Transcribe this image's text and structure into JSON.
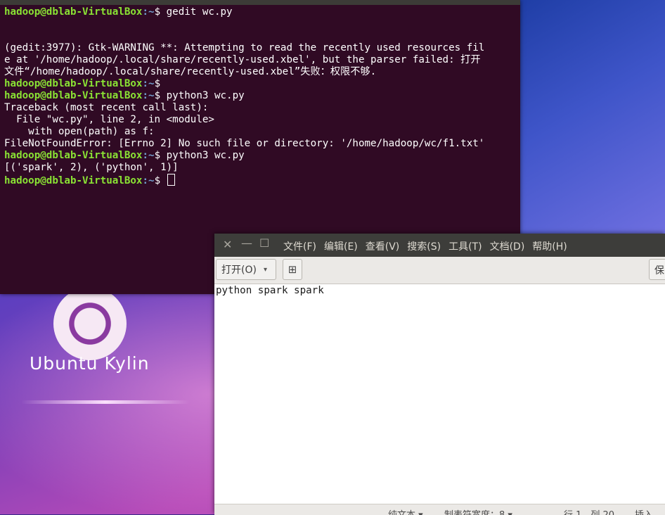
{
  "terminal": {
    "lines": [
      {
        "user": "hadoop@dblab-VirtualBox",
        "path": ":~",
        "text": "$ gedit wc.py"
      },
      {
        "text": ""
      },
      {
        "text": ""
      },
      {
        "text": "(gedit:3977): Gtk-WARNING **: Attempting to read the recently used resources fil"
      },
      {
        "text": "e at '/home/hadoop/.local/share/recently-used.xbel', but the parser failed: 打开"
      },
      {
        "text": "文件“/home/hadoop/.local/share/recently-used.xbel”失败：权限不够."
      },
      {
        "user": "hadoop@dblab-VirtualBox",
        "path": ":~",
        "text": "$"
      },
      {
        "user": "hadoop@dblab-VirtualBox",
        "path": ":~",
        "text": "$ python3 wc.py"
      },
      {
        "text": "Traceback (most recent call last):"
      },
      {
        "text": "  File \"wc.py\", line 2, in <module>"
      },
      {
        "text": "    with open(path) as f:"
      },
      {
        "text": "FileNotFoundError: [Errno 2] No such file or directory: '/home/hadoop/wc/f1.txt'"
      },
      {
        "user": "hadoop@dblab-VirtualBox",
        "path": ":~",
        "text": "$ python3 wc.py"
      },
      {
        "text": "[('spark', 2), ('python', 1)]"
      },
      {
        "user": "hadoop@dblab-VirtualBox",
        "path": ":~",
        "text": "$ "
      }
    ]
  },
  "desktop": {
    "logo_text": "Ubuntu Kylin"
  },
  "gedit": {
    "window_buttons": {
      "close": "✕",
      "minimize": "—",
      "maximize": "☐"
    },
    "menu": [
      "文件(F)",
      "编辑(E)",
      "查看(V)",
      "搜索(S)",
      "工具(T)",
      "文档(D)",
      "帮助(H)"
    ],
    "toolbar": {
      "open_label": "打开(O)",
      "open_caret": "▾",
      "new_tab_icon": "⊞",
      "save_label": "保"
    },
    "editor_text": "python spark spark",
    "status": {
      "language": "纯文本 ▾",
      "tab_width": "制表符宽度：8 ▾",
      "position": "行 1，列 20",
      "mode": "插入"
    }
  }
}
